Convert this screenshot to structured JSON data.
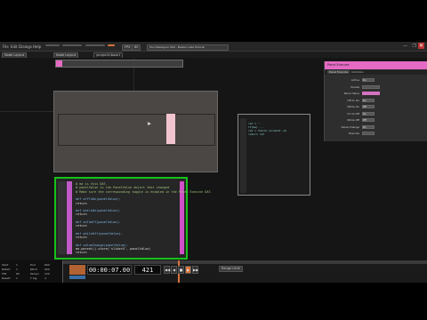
{
  "window": {
    "title_text": "TouchDesigner 099 - Beaker Labs Tutorial",
    "close_glyph": "✕",
    "min_glyph": "—",
    "max_glyph": "❐"
  },
  "menubar": {
    "items": [
      "File",
      "Edit",
      "Dialogs",
      "Help"
    ],
    "fps_label": "FPS",
    "fps_value": "60"
  },
  "tabbar": {
    "pane_label": "Node Layout",
    "path": "/project1/base1"
  },
  "param_panel": {
    "header": "Panel Execute",
    "tabs": [
      "Panel Execute",
      "Common"
    ],
    "rows": [
      {
        "label": "Active",
        "value": "On"
      },
      {
        "label": "Panels",
        "value": ""
      },
      {
        "label": "Panel Value",
        "value": ""
      },
      {
        "label": "Off to On",
        "value": "On"
      },
      {
        "label": "While On",
        "value": "Off"
      },
      {
        "label": "On to Off",
        "value": "On"
      },
      {
        "label": "While Off",
        "value": "Off"
      },
      {
        "label": "Value Change",
        "value": "On"
      },
      {
        "label": "Execute",
        "value": ""
      }
    ]
  },
  "code_left": {
    "lines": [
      "# me is this DAT.",
      "# panelValue is the PanelValue object that changed",
      "# Make sure the corresponding toggle is enabled in the Panel Execute DAT.",
      "",
      "def offToOn(panelValue):",
      "    return",
      "",
      "def whileOn(panelValue):",
      "    return",
      "",
      "def onToOff(panelValue):",
      "    return",
      "",
      "def whileOff(panelValue):",
      "    return",
      "",
      "def valueChange(panelValue):",
      "    me.parent().store('sliderU', panelValue)",
      "    return"
    ]
  },
  "code_right": {
    "lines": [
      "ret = '' ",
      "if(me) ...",
      "ret = fetch('sliderU',0)",
      "return ret"
    ]
  },
  "timeline": {
    "timecode": "00:00:07.00",
    "frame": "421",
    "stats": [
      {
        "label": "Start",
        "value": "1"
      },
      {
        "label": "End",
        "value": "600"
      },
      {
        "label": "RStart",
        "value": "1"
      },
      {
        "label": "REnd",
        "value": "600"
      },
      {
        "label": "FPS",
        "value": "60"
      },
      {
        "label": "Tempo",
        "value": "120"
      },
      {
        "label": "Resetf",
        "value": "1"
      },
      {
        "label": "T Sig",
        "value": "4"
      }
    ],
    "buttons": [
      "◀◀",
      "◀",
      "■",
      "▶",
      "▶▶"
    ],
    "range_label": "Range Limit"
  },
  "colors": {
    "accent_pink": "#e46ac4",
    "accent_orange": "#d9743a",
    "selection_green": "#17c21a"
  }
}
